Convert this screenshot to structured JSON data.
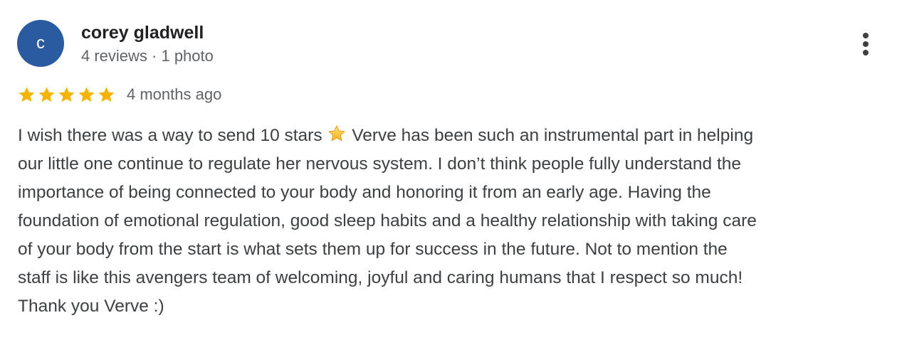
{
  "review": {
    "author": {
      "initial": "c",
      "name": "corey gladwell",
      "meta": "4 reviews · 1 photo",
      "avatar_color": "#2a5aa0"
    },
    "more_icon": "more-vert-icon",
    "rating": {
      "stars": 5,
      "max": 5,
      "star_color": "#f4b400",
      "date": "4 months ago"
    },
    "text": {
      "line1_before": "I wish there was a way to send 10 stars ",
      "inline_emoji": "star-emoji",
      "line1_after": " Verve has been such an instrumental part in helping",
      "lines": [
        "our little one continue to regulate her nervous system. I don’t think people fully understand the",
        "importance of being connected to your body and honoring it from an early age. Having the",
        "foundation of emotional regulation, good sleep habits and a healthy relationship with taking care",
        "of your body from the start is what sets them up for success in the future. Not to mention the",
        "staff is like this avengers team of welcoming, joyful and caring humans that I respect so much!",
        "Thank you Verve :)"
      ]
    }
  }
}
